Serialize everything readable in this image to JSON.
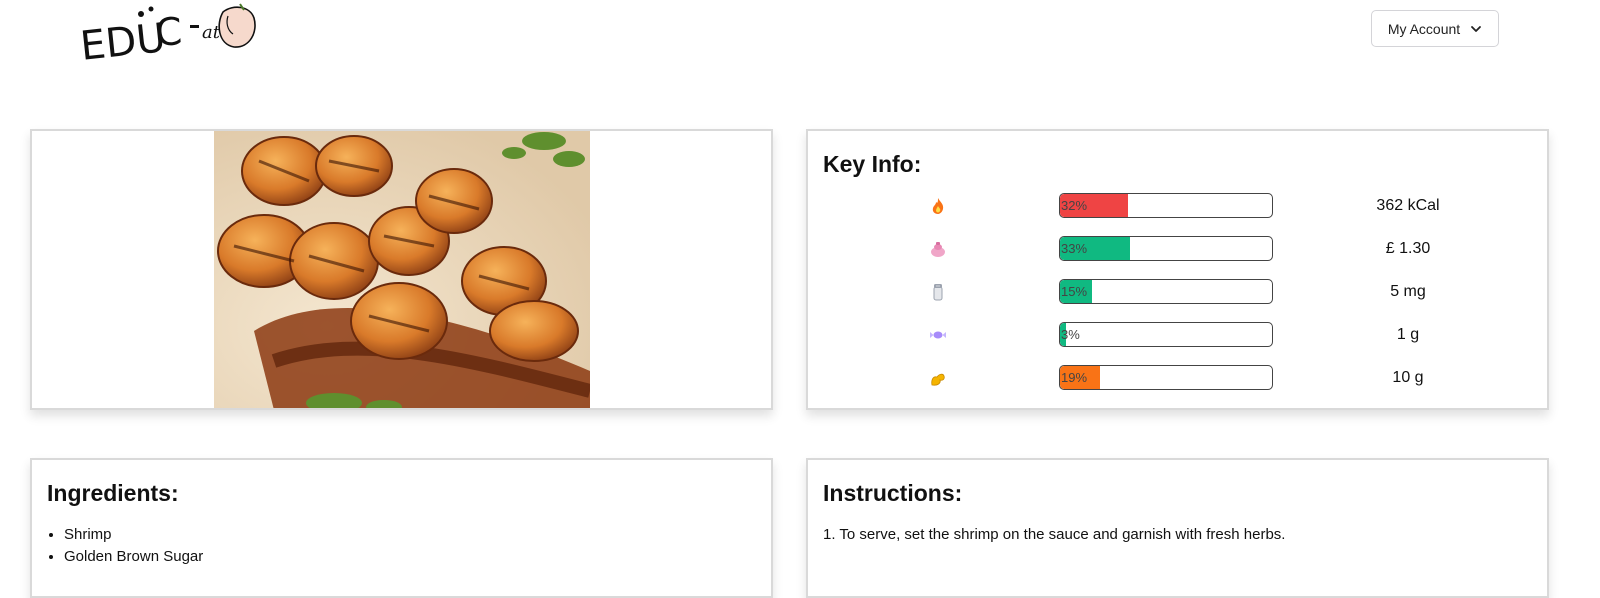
{
  "header": {
    "logo_alt": "EDUC-ate",
    "account_label": "My Account"
  },
  "photo": {
    "alt": "Grilled shrimp on sauce with fresh herbs"
  },
  "key_info": {
    "title": "Key Info:",
    "rows": [
      {
        "icon": "fire-icon",
        "percent_label": "32%",
        "percent": 32,
        "color": "#ef4444",
        "value": "362 kCal"
      },
      {
        "icon": "money-bag-icon",
        "percent_label": "33%",
        "percent": 33,
        "color": "#10b981",
        "value": "£ 1.30"
      },
      {
        "icon": "salt-shaker-icon",
        "percent_label": "15%",
        "percent": 15,
        "color": "#10b981",
        "value": "5 mg"
      },
      {
        "icon": "candy-icon",
        "percent_label": "3%",
        "percent": 3,
        "color": "#10b981",
        "value": "1 g"
      },
      {
        "icon": "flexed-biceps-icon",
        "percent_label": "19%",
        "percent": 19,
        "color": "#f97316",
        "value": "10 g"
      }
    ]
  },
  "ingredients": {
    "title": "Ingredients:",
    "items": [
      "Shrimp",
      "Golden Brown Sugar"
    ]
  },
  "instructions": {
    "title": "Instructions:",
    "steps": [
      "1. To serve, set the shrimp on the sauce and garnish with fresh herbs."
    ]
  }
}
